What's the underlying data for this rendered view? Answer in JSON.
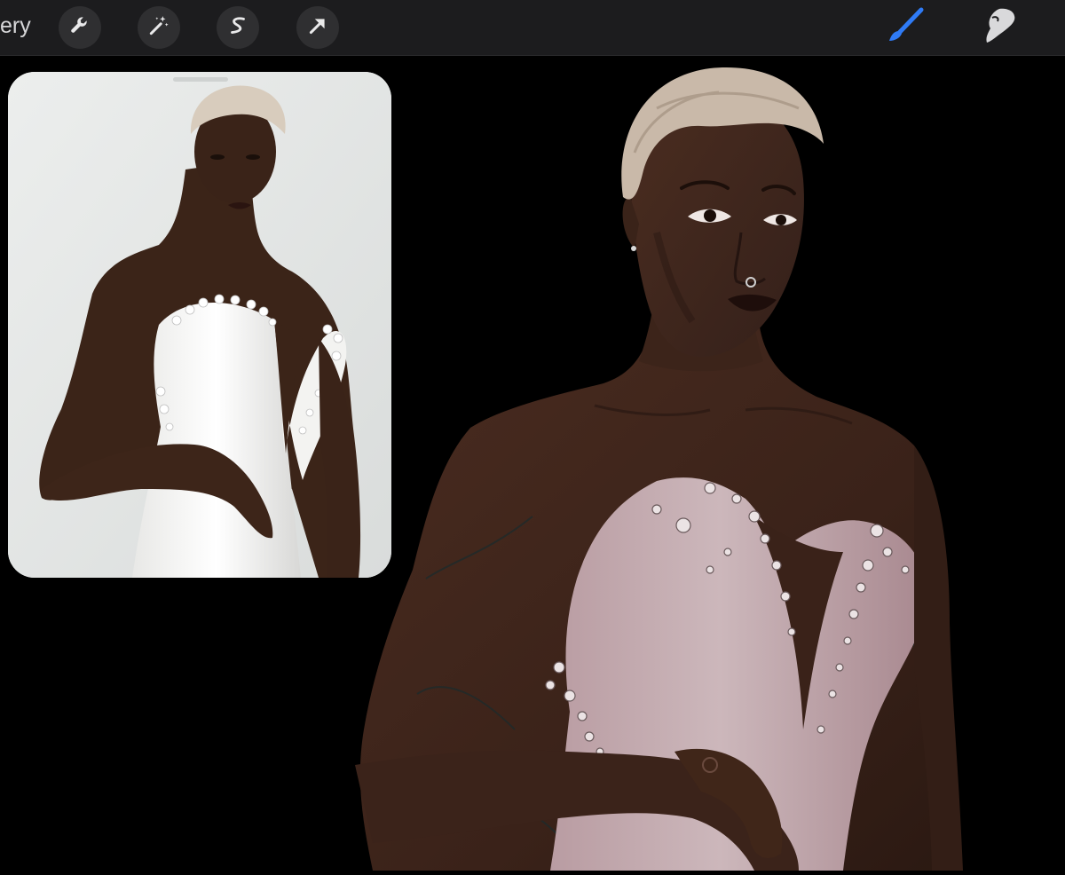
{
  "toolbar": {
    "gallery_label": "ery",
    "left_tools": [
      "wrench-icon",
      "magic-wand-icon",
      "selection-icon",
      "transform-arrow-icon"
    ],
    "right_tools": [
      "brush-icon",
      "smudge-icon"
    ],
    "active_tool": "brush-icon",
    "accent_color": "#2f7bf6"
  },
  "reference": {
    "visible": true,
    "background_color": "#e7e9e8"
  },
  "canvas": {
    "background_color": "#000000",
    "skin_color": "#3a2218",
    "dress_color": "#c9b3b7",
    "hair_color": "#c7b7a6"
  }
}
